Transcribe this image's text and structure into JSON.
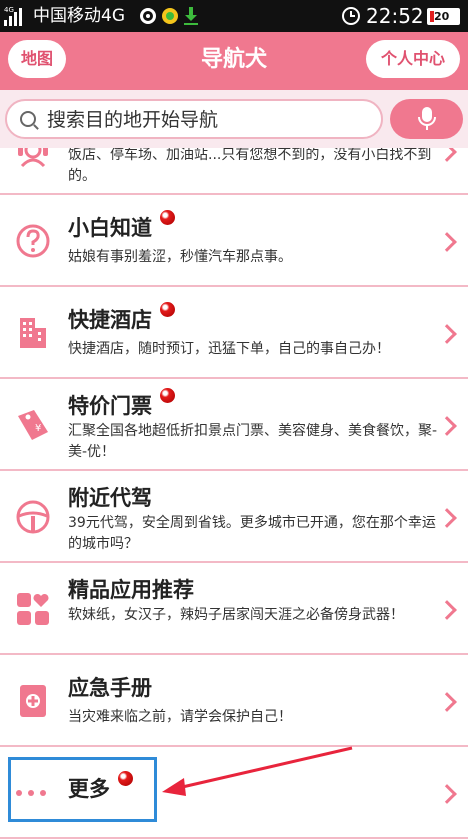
{
  "status_bar": {
    "signal_tag": "4G",
    "carrier": "中国移动4G",
    "time": "22:52",
    "battery": "20",
    "colors": {
      "battery_low": "#e02020",
      "icon_green": "#3dbb3d",
      "icon_yellow": "#f4c51c"
    }
  },
  "header": {
    "map_button": "地图",
    "title": "导航犬",
    "profile_button": "个人中心"
  },
  "search": {
    "placeholder": "搜索目的地开始导航",
    "mic_icon": "microphone-icon"
  },
  "items": [
    {
      "title": "",
      "desc": "饭店、停车场、加油站...只有您想不到的，没有小白找不到的。",
      "icon": "headset-icon",
      "badge": false
    },
    {
      "title": "小白知道",
      "desc": "姑娘有事别羞涩，秒懂汽车那点事。",
      "icon": "question-icon",
      "badge": true
    },
    {
      "title": "快捷酒店",
      "desc": "快捷酒店，随时预订，迅猛下单，自己的事自己办！",
      "icon": "hotel-icon",
      "badge": true
    },
    {
      "title": "特价门票",
      "desc": "汇聚全国各地超低折扣景点门票、美容健身、美食餐饮，聚-美-优！",
      "icon": "ticket-icon",
      "badge": true
    },
    {
      "title": "附近代驾",
      "desc": "39元代驾，安全周到省钱。更多城市已开通，您在那个幸运的城市吗？",
      "icon": "steering-wheel-icon",
      "badge": false
    },
    {
      "title": "精品应用推荐",
      "desc": "软妹纸，女汉子，辣妈子居家闯天涯之必备傍身武器！",
      "icon": "apps-icon",
      "badge": false
    },
    {
      "title": "应急手册",
      "desc": "当灾难来临之前，请学会保护自己！",
      "icon": "first-aid-book-icon",
      "badge": false
    },
    {
      "title": "更多",
      "desc": "",
      "icon": "more-dots-icon",
      "badge": true
    }
  ],
  "theme": {
    "primary": "#f0788f",
    "primary_dark": "#e05270",
    "divider": "#f3b9c6",
    "highlight": "#2f8bd8",
    "arrow": "#e8243c"
  }
}
